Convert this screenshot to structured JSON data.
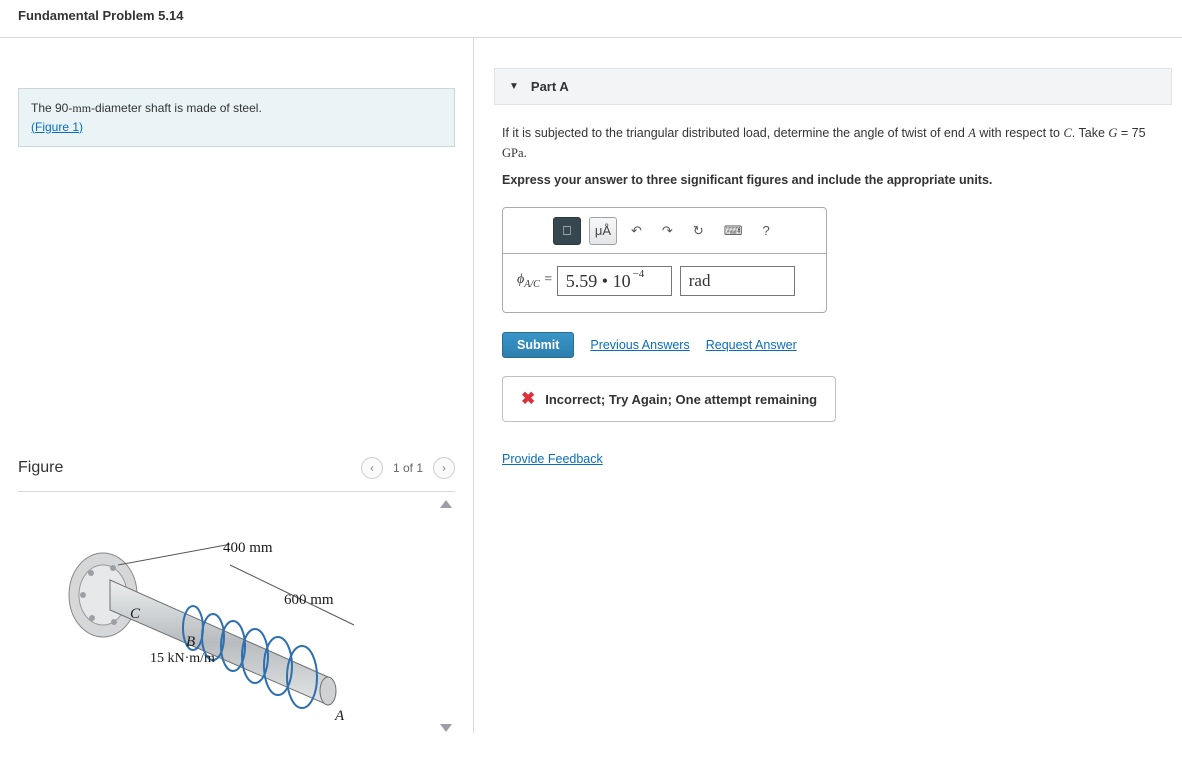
{
  "page_title": "Fundamental Problem 5.14",
  "prompt": {
    "text_pre": "The 90-",
    "mm": "mm",
    "text_post": "-diameter shaft is made of steel.",
    "figure_link": "(Figure 1)"
  },
  "figure": {
    "heading": "Figure",
    "pager": "1 of 1",
    "labels": {
      "seg1": "400 mm",
      "seg2": "600 mm",
      "load": "15 kN·m/m",
      "A": "A",
      "B": "B",
      "C": "C"
    }
  },
  "part": {
    "label": "Part A",
    "question_pre": "If it is subjected to the triangular distributed load, determine the angle of twist of end ",
    "var1": "A",
    "question_mid": " with respect to ",
    "var2": "C",
    "question_post": ". Take ",
    "var3": "G",
    "g_val": " = 75 ",
    "g_unit": "GPa",
    "period": ".",
    "instruction": "Express your answer to three significant figures and include the appropriate units."
  },
  "toolbar": {
    "template": "⎕",
    "microA": "μÅ",
    "undo": "↶",
    "redo": "↷",
    "reset": "↻",
    "keyboard": "⌨",
    "help": "?"
  },
  "answer": {
    "prefix_sym": "ϕ",
    "prefix_sub": "A/C",
    "equals": " = ",
    "value_main": "5.59 • 10",
    "value_exp": "−4",
    "unit": "rad"
  },
  "actions": {
    "submit": "Submit",
    "previous": "Previous Answers",
    "request": "Request Answer"
  },
  "feedback": {
    "text": "Incorrect; Try Again; One attempt remaining"
  },
  "footer": {
    "provide_feedback": "Provide Feedback"
  }
}
